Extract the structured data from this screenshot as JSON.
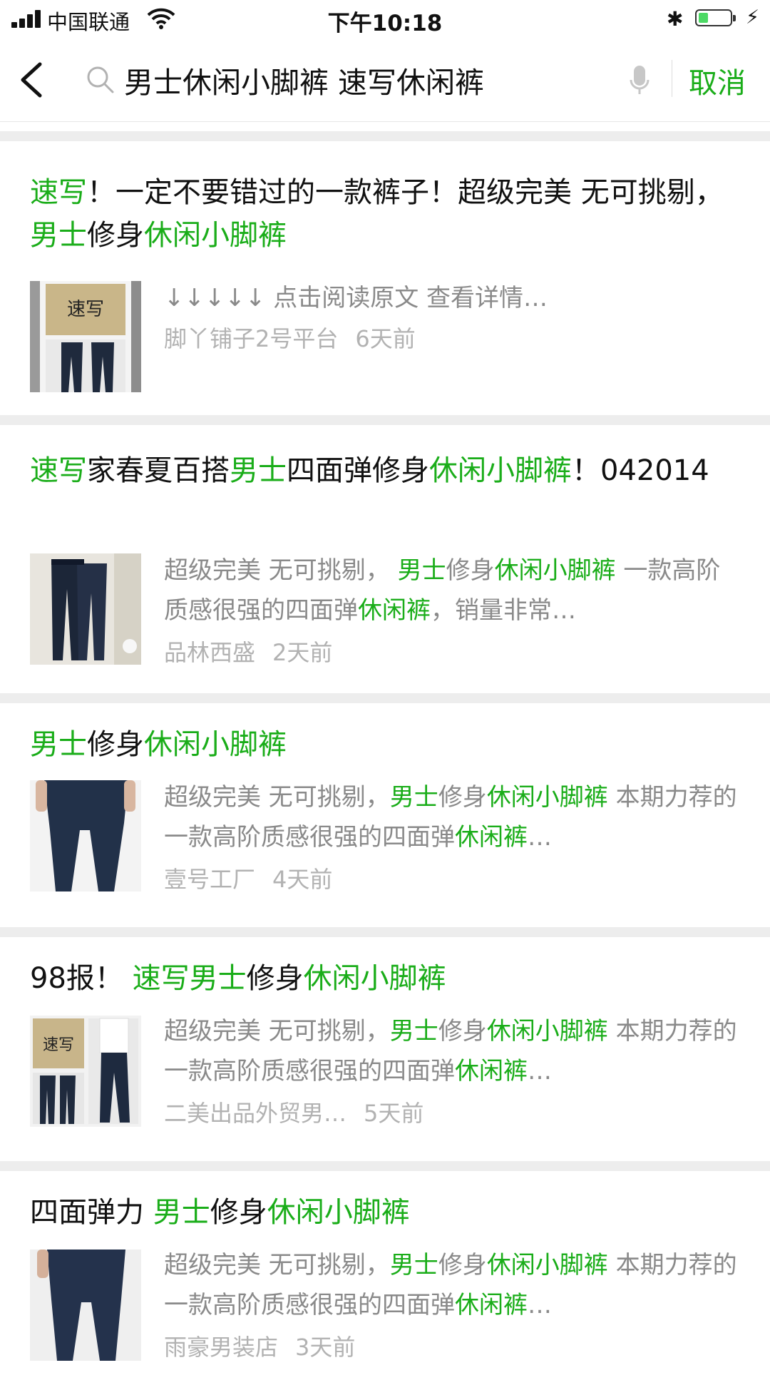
{
  "status": {
    "carrier": "中国联通",
    "time": "下午10:18",
    "battery_level": 0.3
  },
  "nav": {
    "search_value": "男士休闲小脚裤 速写休闲裤",
    "cancel_label": "取消"
  },
  "colors": {
    "accent": "#1aad19",
    "meta": "#b2b2b2",
    "snippet": "#8a8a8a",
    "separator": "#ededed"
  },
  "results": [
    {
      "title": [
        {
          "t": "速写",
          "hl": true
        },
        {
          "t": "！一定不要错过的一款裤子！超级完美 无可挑剔，"
        },
        {
          "t": "男士",
          "hl": true
        },
        {
          "t": "修身"
        },
        {
          "t": "休闲小脚裤",
          "hl": true
        }
      ],
      "snippet": [
        {
          "t": "↓↓↓↓↓ 点击阅读原文 查看详情…"
        }
      ],
      "source": "脚丫铺子2号平台",
      "time": "6天前"
    },
    {
      "title": [
        {
          "t": "速写",
          "hl": true
        },
        {
          "t": "家春夏百搭"
        },
        {
          "t": "男士",
          "hl": true
        },
        {
          "t": "四面弹修身"
        },
        {
          "t": "休闲小脚裤",
          "hl": true
        },
        {
          "t": "！042014"
        }
      ],
      "snippet": [
        {
          "t": "超级完美 无可挑剔， "
        },
        {
          "t": "男士",
          "hl": true
        },
        {
          "t": "修身"
        },
        {
          "t": "休闲小脚裤",
          "hl": true
        },
        {
          "t": " 一款高阶质感很强的四面弹"
        },
        {
          "t": "休闲裤",
          "hl": true
        },
        {
          "t": "，销量非常…"
        }
      ],
      "source": "品林西盛",
      "time": "2天前"
    },
    {
      "title": [
        {
          "t": "男士",
          "hl": true
        },
        {
          "t": "修身"
        },
        {
          "t": "休闲小脚裤",
          "hl": true
        }
      ],
      "snippet": [
        {
          "t": "超级完美 无可挑剔，"
        },
        {
          "t": "男士",
          "hl": true
        },
        {
          "t": "修身"
        },
        {
          "t": "休闲小脚裤",
          "hl": true
        },
        {
          "t": " 本期力荐的一款高阶质感很强的四面弹"
        },
        {
          "t": "休闲裤",
          "hl": true
        },
        {
          "t": "…"
        }
      ],
      "source": "壹号工厂",
      "time": "4天前"
    },
    {
      "title": [
        {
          "t": "98报！ "
        },
        {
          "t": "速写男士",
          "hl": true
        },
        {
          "t": "修身"
        },
        {
          "t": "休闲小脚裤",
          "hl": true
        }
      ],
      "snippet": [
        {
          "t": "超级完美 无可挑剔，"
        },
        {
          "t": "男士",
          "hl": true
        },
        {
          "t": "修身"
        },
        {
          "t": "休闲小脚裤",
          "hl": true
        },
        {
          "t": " 本期力荐的一款高阶质感很强的四面弹"
        },
        {
          "t": "休闲裤",
          "hl": true
        },
        {
          "t": "…"
        }
      ],
      "source": "二美出品外贸男…",
      "time": "5天前"
    },
    {
      "title": [
        {
          "t": "四面弹力 "
        },
        {
          "t": "男士",
          "hl": true
        },
        {
          "t": "修身"
        },
        {
          "t": "休闲小脚裤",
          "hl": true
        }
      ],
      "snippet": [
        {
          "t": "超级完美 无可挑剔，"
        },
        {
          "t": "男士",
          "hl": true
        },
        {
          "t": "修身"
        },
        {
          "t": "休闲小脚裤",
          "hl": true
        },
        {
          "t": " 本期力荐的一款高阶质感很强的四面弹"
        },
        {
          "t": "休闲裤",
          "hl": true
        },
        {
          "t": "…"
        }
      ],
      "source": "雨豪男装店",
      "time": "3天前"
    }
  ]
}
